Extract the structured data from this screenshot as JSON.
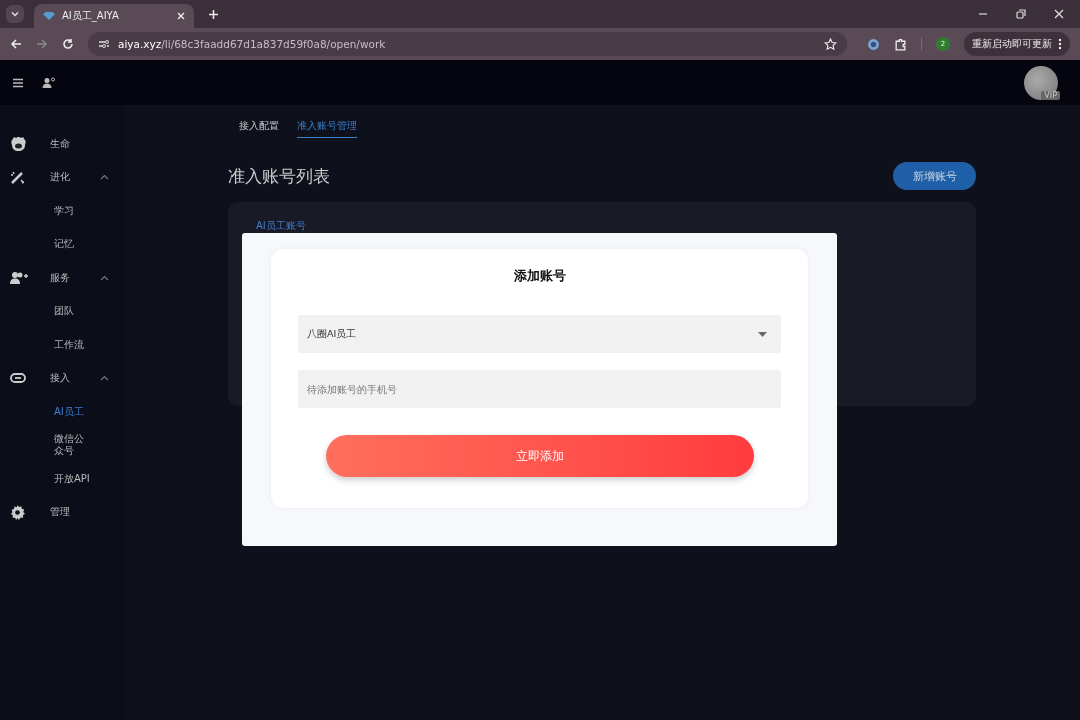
{
  "browser": {
    "tab_title": "AI员工_AIYA",
    "url_host": "aiya.xyz",
    "url_path": "/li/68c3faadd67d1a837d59f0a8/open/work",
    "extension_badge": "2",
    "update_button": "重新启动即可更新"
  },
  "header": {
    "avatar_badge": "VIP"
  },
  "sidebar": {
    "items": [
      {
        "label": "生命",
        "selected": false
      },
      {
        "label": "进化",
        "expanded": true,
        "selected": false,
        "children": [
          {
            "label": "学习",
            "selected": false
          },
          {
            "label": "记忆",
            "selected": false
          }
        ]
      },
      {
        "label": "服务",
        "expanded": true,
        "selected": false,
        "children": [
          {
            "label": "团队",
            "selected": false
          },
          {
            "label": "工作流",
            "selected": false
          }
        ]
      },
      {
        "label": "接入",
        "expanded": true,
        "selected": false,
        "children": [
          {
            "label": "AI员工",
            "selected": true
          },
          {
            "label": "微信公众号",
            "selected": false
          },
          {
            "label": "开放API",
            "selected": false
          }
        ]
      },
      {
        "label": "管理",
        "selected": false
      }
    ]
  },
  "tabs": [
    {
      "label": "接入配置",
      "selected": false
    },
    {
      "label": "准入账号管理",
      "selected": true
    }
  ],
  "page": {
    "title": "准入账号列表",
    "add_button": "新增账号",
    "card_label": "AI员工账号"
  },
  "dialog": {
    "title": "添加账号",
    "select_value": "八圈AI员工",
    "phone_placeholder": "待添加账号的手机号",
    "submit": "立即添加"
  }
}
